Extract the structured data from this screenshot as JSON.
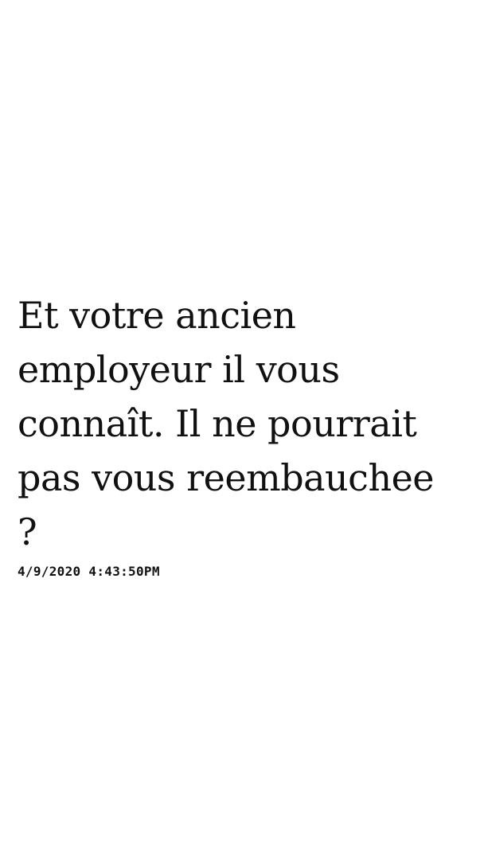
{
  "message": {
    "text": "Et votre ancien\nemployeur il vous\nconnaît. Il ne pourrait\npas vous reembauchee\n?",
    "timestamp": "4/9/2020 4:43:50PM"
  }
}
